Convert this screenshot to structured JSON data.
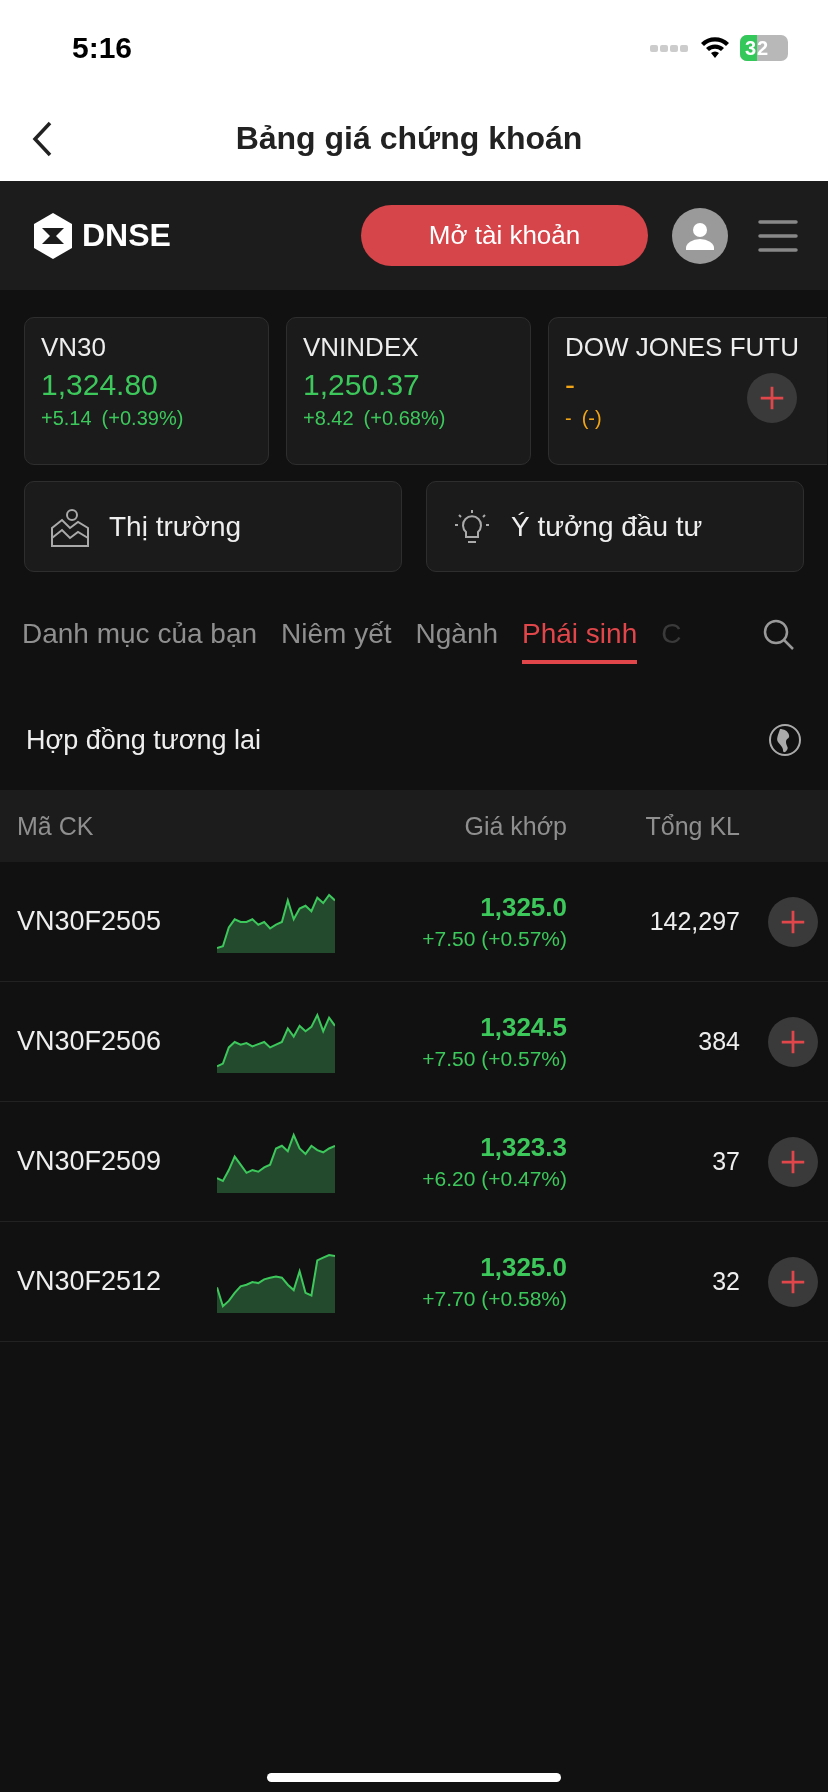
{
  "status_bar": {
    "time": "5:16",
    "battery": "32"
  },
  "nav": {
    "title": "Bảng giá chứng khoán"
  },
  "header": {
    "logo": "DNSE",
    "open_account_button": "Mở tài khoản"
  },
  "indices": [
    {
      "name": "VN30",
      "value": "1,324.80",
      "change": "+5.14",
      "percent": "(+0.39%)",
      "color": "#3dc85c"
    },
    {
      "name": "VNINDEX",
      "value": "1,250.37",
      "change": "+8.42",
      "percent": "(+0.68%)",
      "color": "#3dc85c"
    },
    {
      "name": "DOW JONES FUTU",
      "value": "-",
      "change": "-",
      "percent": "(-)",
      "color": "#f2a516"
    }
  ],
  "shortcuts": [
    {
      "label": "Thị trường",
      "kind": "market"
    },
    {
      "label": "Ý tưởng đầu tư",
      "kind": "idea"
    }
  ],
  "tabs": [
    {
      "label": "Danh mục của bạn",
      "selected": false
    },
    {
      "label": "Niêm yết",
      "selected": false
    },
    {
      "label": "Ngành",
      "selected": false
    },
    {
      "label": "Phái sinh",
      "selected": true
    },
    {
      "label": "C",
      "selected": false
    }
  ],
  "section": {
    "title": "Hợp đồng tương lai"
  },
  "table": {
    "columns": [
      "Mã CK",
      "Giá khớp",
      "Tổng KL"
    ],
    "rows": [
      {
        "symbol": "VN30F2505",
        "price": "1,325.0",
        "change": "+7.50 (+0.57%)",
        "volume": "142,297",
        "color": "#3dc85c"
      },
      {
        "symbol": "VN30F2506",
        "price": "1,324.5",
        "change": "+7.50 (+0.57%)",
        "volume": "384",
        "color": "#3dc85c"
      },
      {
        "symbol": "VN30F2509",
        "price": "1,323.3",
        "change": "+6.20 (+0.47%)",
        "volume": "37",
        "color": "#3dc85c"
      },
      {
        "symbol": "VN30F2512",
        "price": "1,325.0",
        "change": "+7.70 (+0.58%)",
        "volume": "32",
        "color": "#3dc85c"
      }
    ]
  }
}
